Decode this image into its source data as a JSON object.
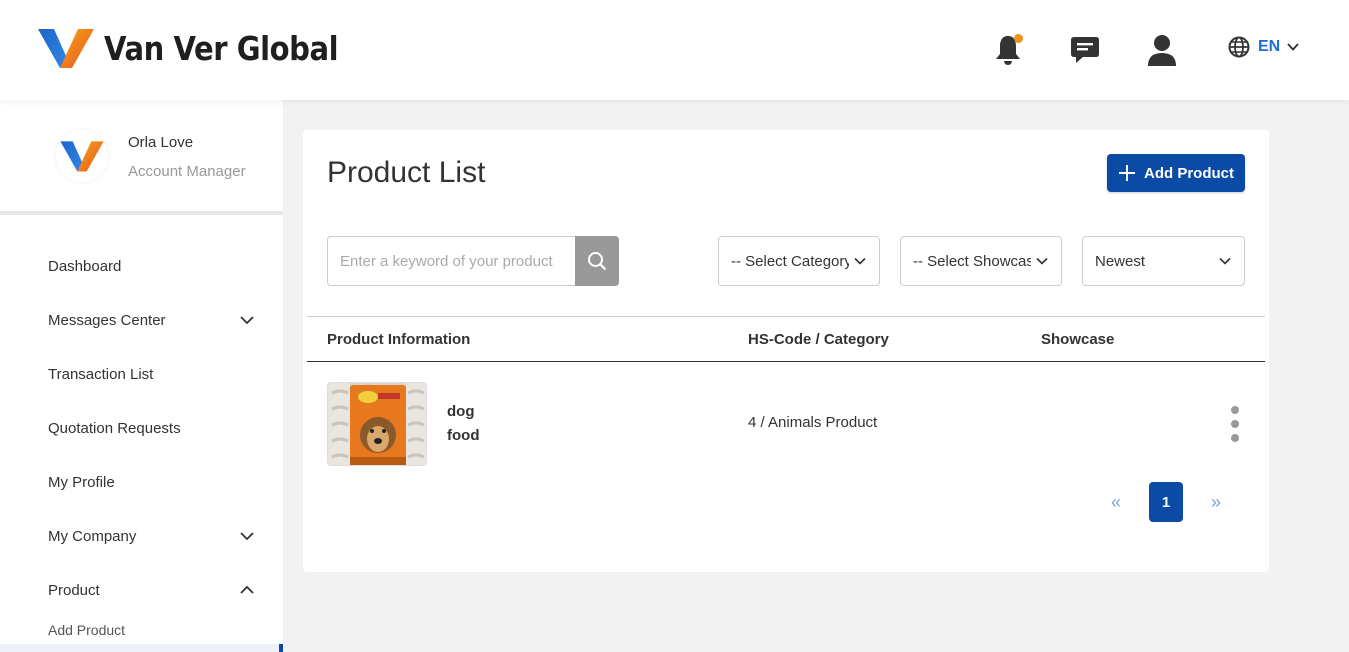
{
  "header": {
    "brand_name": "Van Ver Global",
    "language": "EN",
    "notification_dot_color": "#f0901e",
    "icons": [
      "bell-icon",
      "chat-icon",
      "user-icon",
      "globe-icon",
      "chevron-down-icon"
    ]
  },
  "sidebar": {
    "user": {
      "name": "Orla Love",
      "role": "Account Manager"
    },
    "items": [
      {
        "label": "Dashboard"
      },
      {
        "label": "Messages Center",
        "chevron": "down"
      },
      {
        "label": "Transaction List"
      },
      {
        "label": "Quotation Requests"
      },
      {
        "label": "My Profile"
      },
      {
        "label": "My Company",
        "chevron": "down"
      },
      {
        "label": "Product",
        "chevron": "up"
      }
    ],
    "subitems": [
      {
        "label": "Add Product"
      }
    ]
  },
  "main": {
    "title": "Product List",
    "add_button_label": "Add Product",
    "search": {
      "placeholder": "Enter a keyword of your product",
      "value": ""
    },
    "filters": {
      "category": "-- Select Category",
      "showcase": "-- Select Showcase",
      "sort": "Newest"
    },
    "table": {
      "headers": [
        "Product Information",
        "HS-Code / Category",
        "Showcase"
      ],
      "rows": [
        {
          "name_line1": "dog",
          "name_line2": "food",
          "category": "4 / Animals Product",
          "showcase": ""
        }
      ]
    },
    "pagination": {
      "prev": "«",
      "current": "1",
      "next": "»"
    }
  },
  "colors": {
    "primary": "#0b4aa5",
    "accent_orange": "#f0901e",
    "link_blue": "#1a6fd8"
  }
}
